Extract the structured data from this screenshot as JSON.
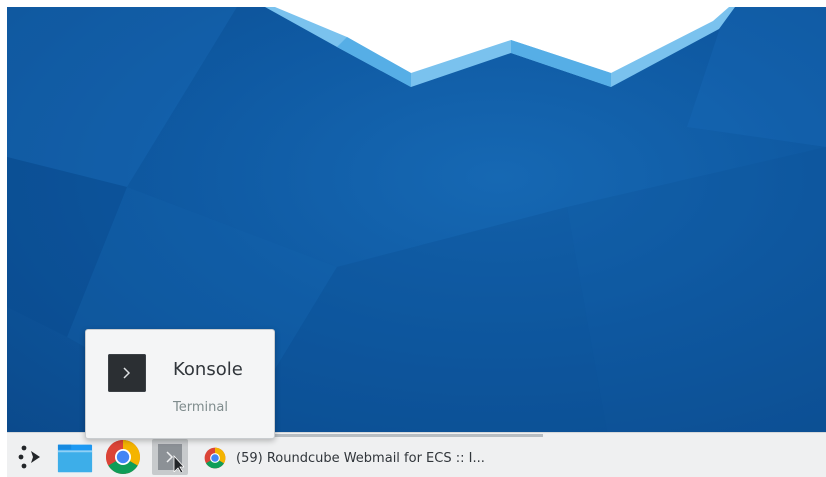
{
  "tooltip": {
    "title": "Konsole",
    "subtitle": "Terminal",
    "icon": "terminal-icon"
  },
  "taskbar": {
    "launchers": [
      {
        "name": "application-launcher",
        "icon": "kde-launcher-icon"
      },
      {
        "name": "file-manager",
        "icon": "folder-icon"
      },
      {
        "name": "chrome",
        "icon": "chrome-icon"
      },
      {
        "name": "konsole",
        "icon": "terminal-icon"
      }
    ],
    "task": {
      "icon": "chrome-icon",
      "label": "(59) Roundcube Webmail for ECS :: I..."
    }
  },
  "colors": {
    "desktop": "#0f5aa3",
    "taskbar": "#eff0f1",
    "accent": "#1d99f3"
  }
}
